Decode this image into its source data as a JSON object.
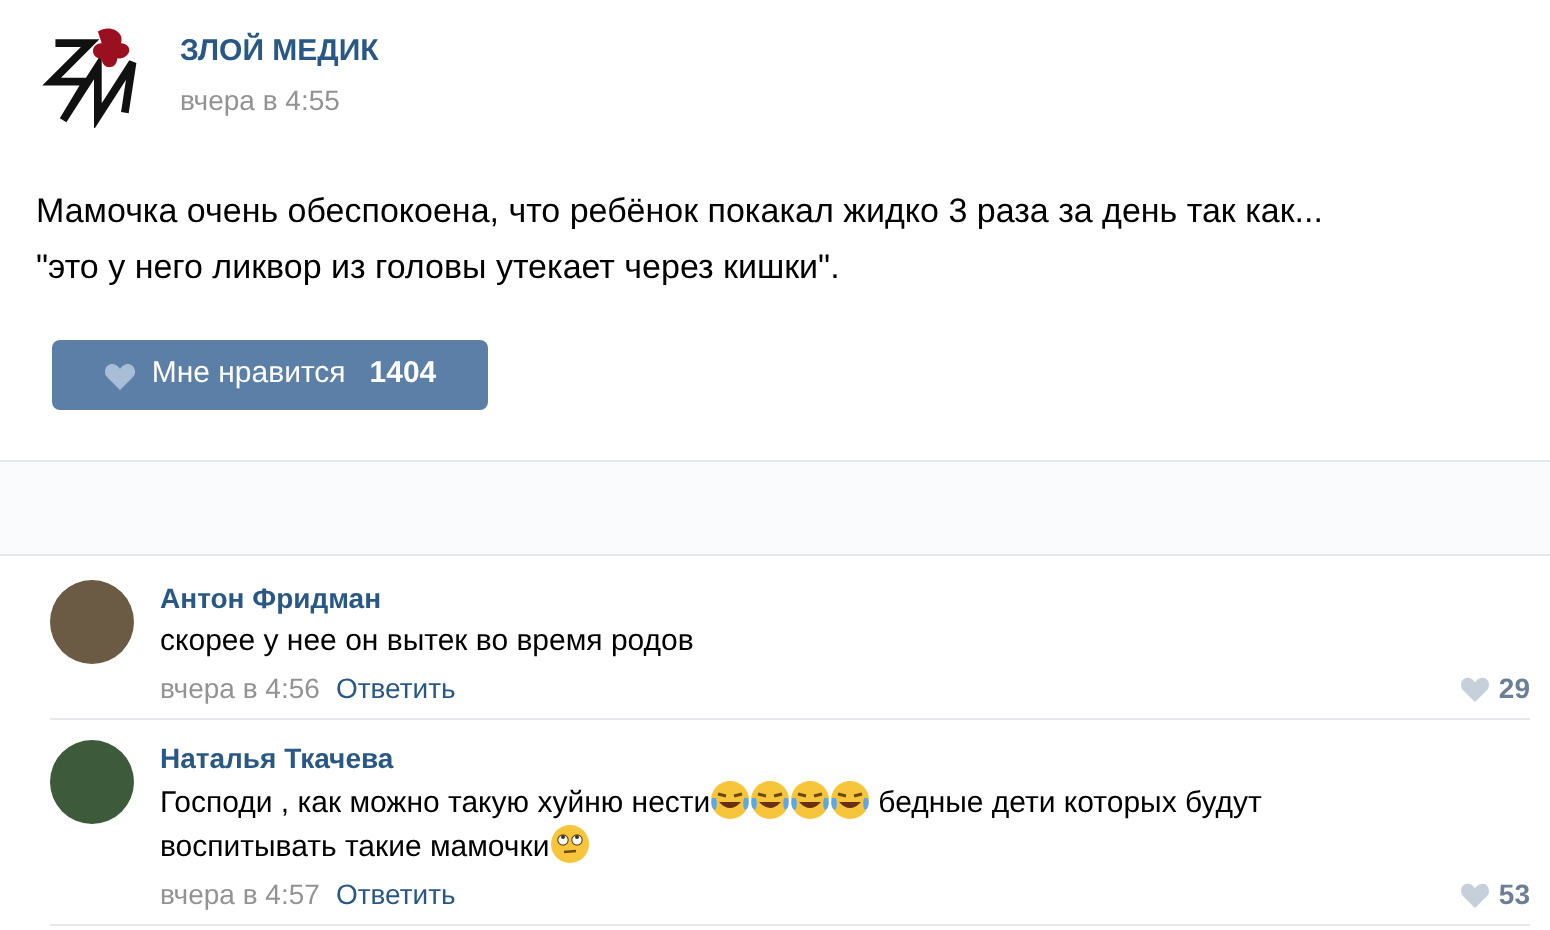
{
  "post": {
    "author": "ЗЛОЙ МЕДИК",
    "time": "вчера в 4:55",
    "text": [
      "Мамочка очень обеспокоена, что ребёнок покакал жидко 3 раза за день так как...",
      "\"это у него ликвор из головы утекает через кишки\"."
    ],
    "like_button": {
      "label": "Мне нравится",
      "count": "1404",
      "liked": false
    }
  },
  "comments": [
    {
      "author": "Антон Фридман",
      "lines": [
        [
          {
            "kind": "text",
            "text": "скорее у нее он вытек во время родов"
          }
        ]
      ],
      "time": "вчера в 4:56",
      "reply": "Ответить",
      "likes": "29"
    },
    {
      "author": "Наталья Ткачева",
      "lines": [
        [
          {
            "kind": "text",
            "text": "Господи , как можно такую хуйню нести"
          },
          {
            "kind": "laugh"
          },
          {
            "kind": "laugh"
          },
          {
            "kind": "laugh"
          },
          {
            "kind": "laugh"
          },
          {
            "kind": "text",
            "text": "бедные дети которых будут"
          }
        ],
        [
          {
            "kind": "text",
            "text": "воспитывать такие мамочки"
          },
          {
            "kind": "eyeroll"
          }
        ]
      ],
      "time": "вчера в 4:57",
      "reply": "Ответить",
      "likes": "53"
    }
  ]
}
